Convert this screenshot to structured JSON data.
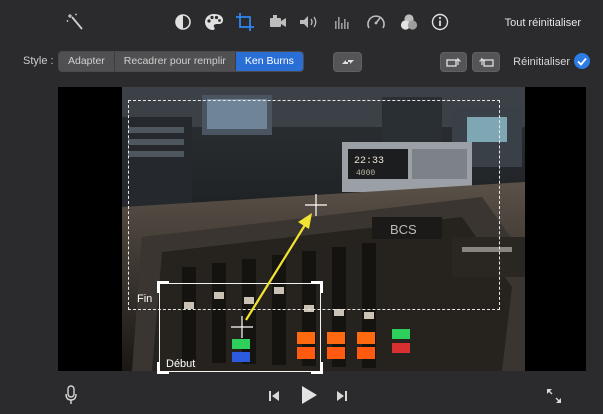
{
  "toolbar": {
    "icons": [
      "magic-wand-icon",
      "color-balance-icon",
      "color-palette-icon",
      "crop-icon",
      "camera-icon",
      "volume-icon",
      "equalizer-icon",
      "speedometer-icon",
      "filter-icon",
      "info-icon"
    ],
    "active_icon": "crop-icon",
    "reset_all_label": "Tout réinitialiser"
  },
  "style_bar": {
    "label": "Style :",
    "options": [
      "Adapter",
      "Recadrer pour remplir",
      "Ken Burns"
    ],
    "selected": "Ken Burns",
    "reset_label": "Réinitialiser"
  },
  "viewer": {
    "end_frame_label": "Fin",
    "start_frame_label": "Début",
    "display_time": "22:33",
    "display_sub": "4000",
    "brand_text": "BCS"
  },
  "colors": {
    "accent": "#2a6fd6",
    "arrow": "#f3e332",
    "background": "#2b2b2d"
  }
}
